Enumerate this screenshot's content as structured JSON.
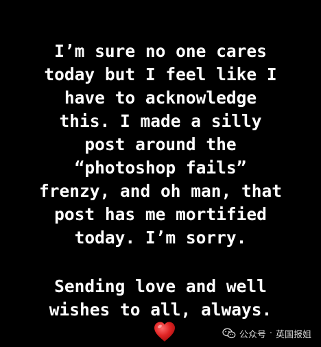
{
  "post": {
    "paragraph1": [
      "I’m sure no one cares",
      "today but I feel like I",
      "have to acknowledge",
      "this. I made a silly",
      "post around the",
      "“photoshop fails”",
      "frenzy, and oh man, that",
      "post has me mortified",
      "today. I’m sorry."
    ],
    "paragraph2": [
      "Sending love and well",
      "wishes to all, always."
    ],
    "emoji": "heart-icon"
  },
  "watermark": {
    "platform": "公众号",
    "separator": "·",
    "account": "英国报姐",
    "icon": "wechat-icon"
  },
  "colors": {
    "background": "#000000",
    "text": "#ffffff",
    "heart": "#e02424",
    "watermark": "#d8d8d8"
  }
}
